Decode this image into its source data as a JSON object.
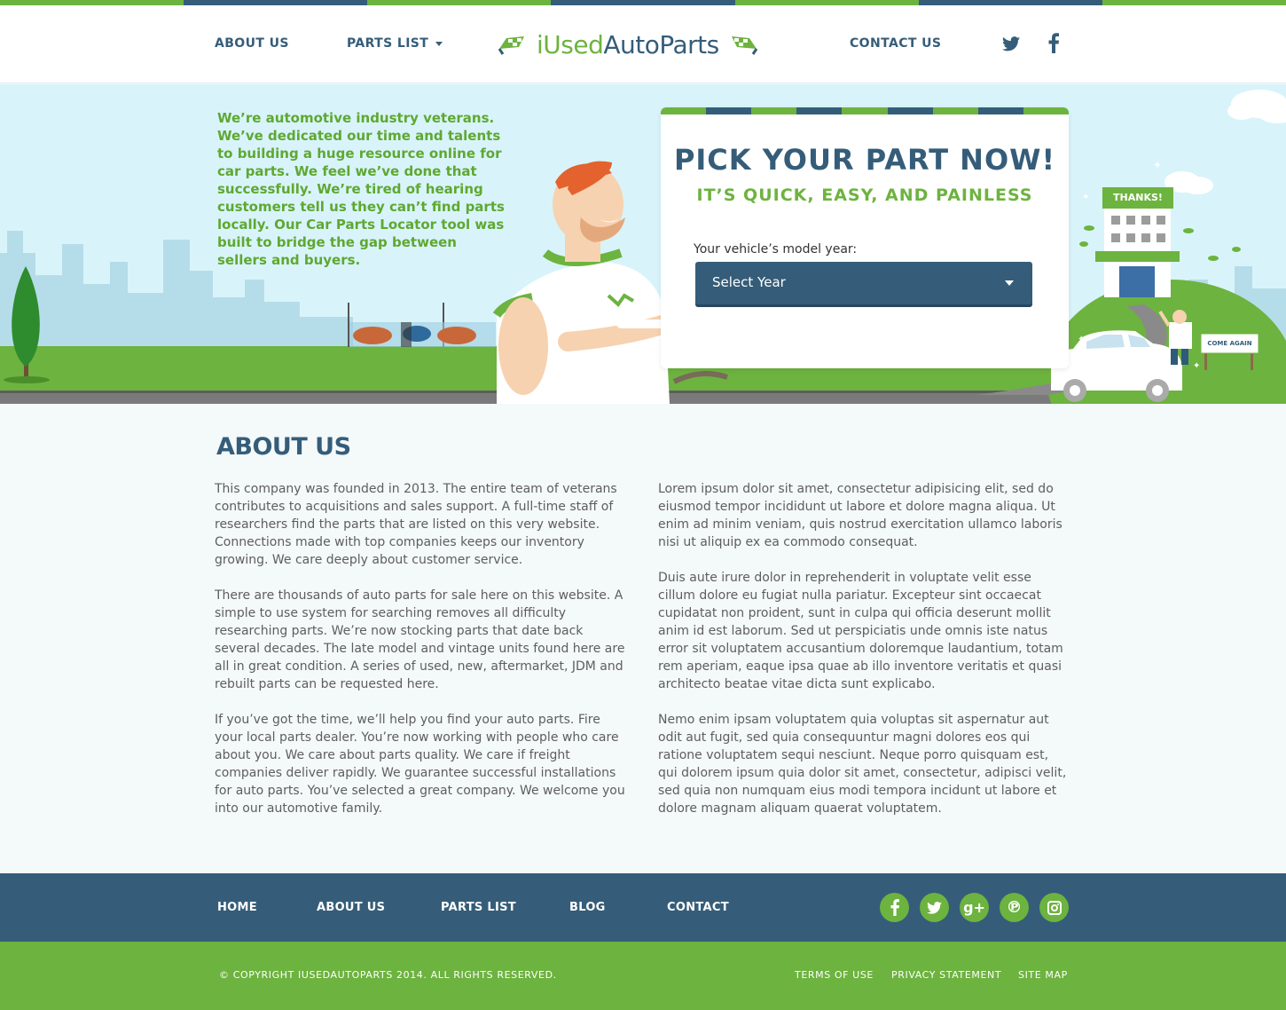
{
  "colors": {
    "navy": "#355d79",
    "green": "#6db33f",
    "sky": "#d8f4fa"
  },
  "header": {
    "nav": {
      "about_us": "ABOUT US",
      "parts_list": "PARTS LIST",
      "contact_us": "CONTACT US"
    },
    "logo": {
      "part1": "iUsed",
      "part2": "AutoParts"
    },
    "social": [
      "twitter-icon",
      "facebook-icon"
    ]
  },
  "hero": {
    "intro": "We’re automotive industry veterans. We’ve dedicated our time and talents to building a huge resource online for car parts. We feel we’ve done that successfully. We’re tired of hearing customers tell us they can’t find parts locally. Our Car Parts Locator tool was built to bridge the gap between sellers and buyers.",
    "building_sign": "THANKS!",
    "road_sign": "COME AGAIN"
  },
  "picker": {
    "title": "PICK YOUR PART NOW!",
    "subtitle": "IT’S QUICK, EASY, AND PAINLESS",
    "year_label": "Your vehicle’s model year:",
    "year_select": "Select Year"
  },
  "about": {
    "title": "ABOUT US",
    "left": [
      "This company was founded in 2013. The entire team of veterans contributes to acquisitions and sales support. A full-time staff of researchers find the parts that are listed on this very website. Connections made with top companies keeps our inventory growing. We care deeply about customer service.",
      "There are thousands of auto parts for sale here on this website. A simple to use system for searching removes all difficulty researching parts. We’re now stocking parts that date back several decades. The late model and vintage units found here are all in great condition. A series of used, new, aftermarket, JDM and rebuilt parts can be requested here.",
      "If you’ve got the time, we’ll help you find your auto parts. Fire your local parts dealer. You’re now working with people who care about you. We care about parts quality. We care if freight companies deliver rapidly. We guarantee successful installations for auto parts. You’ve selected a great company. We welcome you into our automotive family."
    ],
    "right": [
      "Lorem ipsum dolor sit amet, consectetur adipisicing elit, sed do eiusmod tempor incididunt ut labore et dolore magna aliqua. Ut enim ad minim veniam, quis nostrud exercitation ullamco laboris nisi ut aliquip ex ea commodo consequat.",
      "Duis aute irure dolor in reprehenderit in voluptate velit esse cillum dolore eu fugiat nulla pariatur. Excepteur sint occaecat cupidatat non proident, sunt in culpa qui officia deserunt mollit anim id est laborum. Sed ut perspiciatis unde omnis iste natus error sit voluptatem accusantium doloremque laudantium, totam rem aperiam, eaque ipsa quae ab illo inventore veritatis et quasi architecto beatae vitae dicta sunt explicabo.",
      "Nemo enim ipsam voluptatem quia voluptas sit aspernatur aut odit aut fugit, sed quia consequuntur magni dolores eos qui ratione voluptatem sequi nesciunt. Neque porro quisquam est, qui dolorem ipsum quia dolor sit amet, consectetur, adipisci velit, sed quia non numquam eius modi tempora incidunt ut labore et dolore magnam aliquam quaerat voluptatem."
    ]
  },
  "footer": {
    "nav": [
      "HOME",
      "ABOUT US",
      "PARTS LIST",
      "BLOG",
      "CONTACT"
    ],
    "social": [
      "facebook-icon",
      "twitter-icon",
      "google-plus-icon",
      "pinterest-icon",
      "instagram-icon"
    ],
    "copyright": "© COPYRIGHT IUSEDAUTOPARTS 2014. ALL RIGHTS RESERVED.",
    "links": [
      "TERMS OF USE",
      "PRIVACY STATEMENT",
      "SITE MAP"
    ]
  }
}
